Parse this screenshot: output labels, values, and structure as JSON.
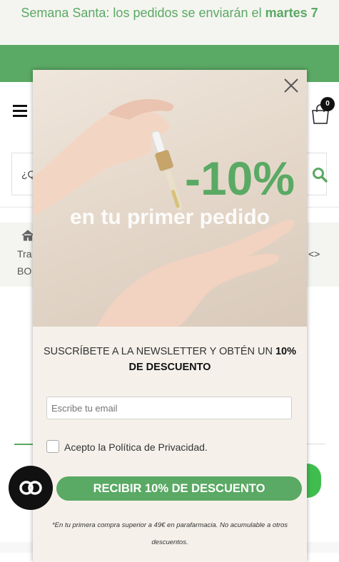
{
  "announcement": {
    "text": "Semana Santa: los pedidos se enviarán el ",
    "highlight": "martes 7"
  },
  "social": {
    "icon": "instagram-icon"
  },
  "header": {
    "menu_icon": "hamburger-icon",
    "cart_icon": "shopping-bag-icon",
    "cart_count": "0"
  },
  "search": {
    "placeholder": "¿Q",
    "icon": "search-icon"
  },
  "breadcrumb": {
    "home_icon": "home-icon",
    "line1": "Tra",
    "line2": "BO",
    "nav": "<>"
  },
  "modal": {
    "close_icon": "close-icon",
    "hero_discount": "-10%",
    "hero_tagline": "en tu primer pedido",
    "subscribe_text": "SUSCRÍBETE A LA NEWSLETTER Y OBTÉN UN ",
    "subscribe_bold": "10% DE DESCUENTO",
    "email_placeholder": "Escribe tu email",
    "privacy_label": "Acepto la Política de Privacidad.",
    "cta_label": "RECIBIR 10% DE DESCUENTO",
    "fine_print": "*En tu primera compra superior a 49€ en parafarmacia. No acumulable a otros descuentos."
  },
  "colors": {
    "brand_green": "#5aa964",
    "announce_bg": "#f4f5f0",
    "modal_bg": "#f5f1ea"
  }
}
